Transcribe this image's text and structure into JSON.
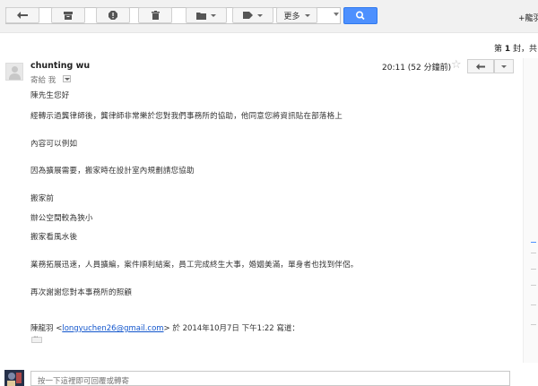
{
  "header": {
    "search_placeholder": "",
    "user_link": "+龍羽"
  },
  "toolbar": {
    "more_label": "更多",
    "page_info": {
      "prefix": "第 ",
      "page": "1",
      "suffix": " 封，共"
    }
  },
  "message": {
    "sender": "chunting wu",
    "recipient": "寄給 我",
    "timestamp": "20:11 (52 分鐘前)",
    "body": [
      "陳先生您好",
      "經轉示過龔律師後，龔律師非常樂於您對我們事務所的協助，他同意您將資訊貼在部落格上",
      "內容可以例如",
      "因為擴展需要，搬家時在設計室內規劃請您協助",
      "搬家前",
      "辦公空間較為狹小",
      "搬家看風水後",
      "業務拓展迅速，人員擴編，案件順利結案，員工完成終生大事，婚姻美滿，單身者也找到伴侶。",
      "再次謝謝您對本事務所的照顧"
    ],
    "quote": {
      "name": "陳龍羽 <",
      "email": "longyuchen26@gmail.com",
      "rest": "> 於 2014年10月7日 下午1:22 寫道："
    }
  },
  "reply": {
    "placeholder": "按一下這裡即可回覆或轉寄"
  },
  "colors": {
    "accent": "#4d90fe",
    "link": "#1155cc"
  }
}
